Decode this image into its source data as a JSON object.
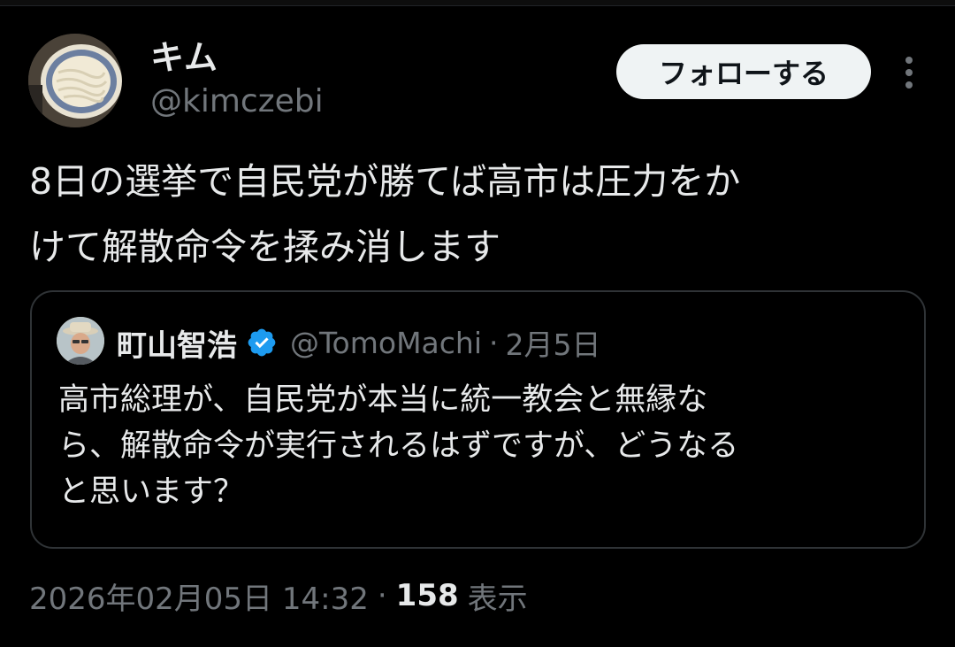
{
  "tweet": {
    "author": {
      "name": "キム",
      "handle": "@kimczebi",
      "avatar": "udon-bowl-avatar"
    },
    "follow_label": "フォローする",
    "more_icon": "more-vertical-icon",
    "text": "8日の選挙で自民党が勝てば高市は圧力をか\nけて解散命令を揉み消します",
    "quote": {
      "author_name": "町山智浩",
      "verified_icon": "verified-badge-icon",
      "verified_color": "#1d9bf0",
      "handle": "@TomoMachi",
      "dot": "·",
      "date": "2月5日",
      "text": "高市総理が、自民党が本当に統一教会と無縁な\nら、解散命令が実行されるはずですが、どうなる\nと思います？"
    },
    "meta": {
      "timestamp": "2026年02月05日 14:32",
      "dot": "·",
      "views_count": "158",
      "views_label": "表示"
    }
  },
  "colors": {
    "background": "#000000",
    "text_primary": "#e7e9ea",
    "text_secondary": "#71767b",
    "border": "#2f3336",
    "button_bg": "#eff3f4",
    "button_text": "#0f1419"
  }
}
